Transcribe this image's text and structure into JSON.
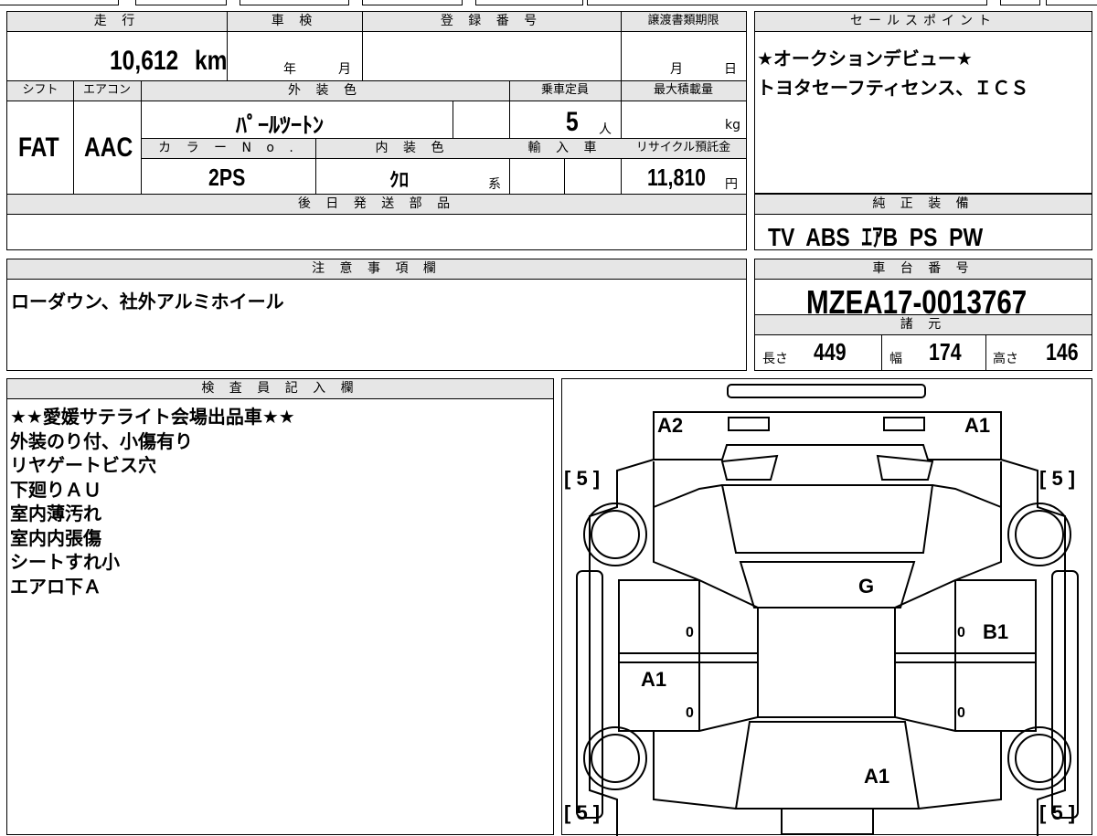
{
  "main_table": {
    "mileage_header": "走 行",
    "mileage_value": "10,612",
    "mileage_unit": "km",
    "shaken_header": "車 検",
    "shaken_year": "年",
    "shaken_month": "月",
    "reg_header": "登 録 番 号",
    "transfer_header": "譲渡書類期限",
    "transfer_month": "月",
    "transfer_day": "日",
    "shift_header": "シフト",
    "shift_value": "FAT",
    "ac_header": "エアコン",
    "ac_value": "AAC",
    "exterior_header": "外 装 色",
    "exterior_value": "ﾊﾟｰﾙﾂｰﾄﾝ",
    "seating_header": "乗車定員",
    "seating_value": "5",
    "seating_unit": "人",
    "load_header": "最大積載量",
    "load_unit": "kg",
    "colorno_header": "カ ラ ー N o .",
    "colorno_value": "2PS",
    "interior_header": "内 装 色",
    "interior_value": "ｸﾛ",
    "interior_suffix": "系",
    "import_header": "輸 入 車",
    "recycle_header": "リサイクル預託金",
    "recycle_value": "11,810",
    "recycle_unit": "円",
    "later_parts_header": "後 日 発 送 部 品"
  },
  "sales_points": {
    "header": "セールスポイント",
    "lines": [
      "★オークションデビュー★",
      "トヨタセーフティセンス、ＩＣＳ"
    ]
  },
  "genuine_equipment": {
    "header": "純 正 装 備",
    "value": "TV  ABS  ｴｱB  PS  PW"
  },
  "caution": {
    "header": "注 意 事 項 欄",
    "value": "ローダウン、社外アルミホイール"
  },
  "chassis": {
    "header": "車 台 番 号",
    "value": "MZEA17-0013767"
  },
  "specs": {
    "header": "諸 元",
    "length_label": "長さ",
    "length_value": "449",
    "width_label": "幅",
    "width_value": "174",
    "height_label": "高さ",
    "height_value": "146"
  },
  "inspector": {
    "header": "検 査 員 記 入 欄",
    "lines": [
      "★★愛媛サテライト会場出品車★★",
      "外装のり付、小傷有り",
      "リヤゲートビス穴",
      "下廻りＡＵ",
      "室内薄汚れ",
      "室内内張傷",
      "シートすれ小",
      "エアロ下Ａ"
    ]
  },
  "diagram": {
    "tire_tl": "[ 5 ]",
    "tire_tr": "[ 5 ]",
    "tire_bl": "[ 5 ]",
    "tire_br": "[ 5 ]",
    "mark_a2": "A2",
    "mark_a1_rear": "A1",
    "mark_g": "G",
    "mark_b1": "B1",
    "mark_a1_left": "A1",
    "mark_a1_front": "A1",
    "zero_lu": "0",
    "zero_ll": "0",
    "zero_ru": "0",
    "zero_rl": "0"
  }
}
